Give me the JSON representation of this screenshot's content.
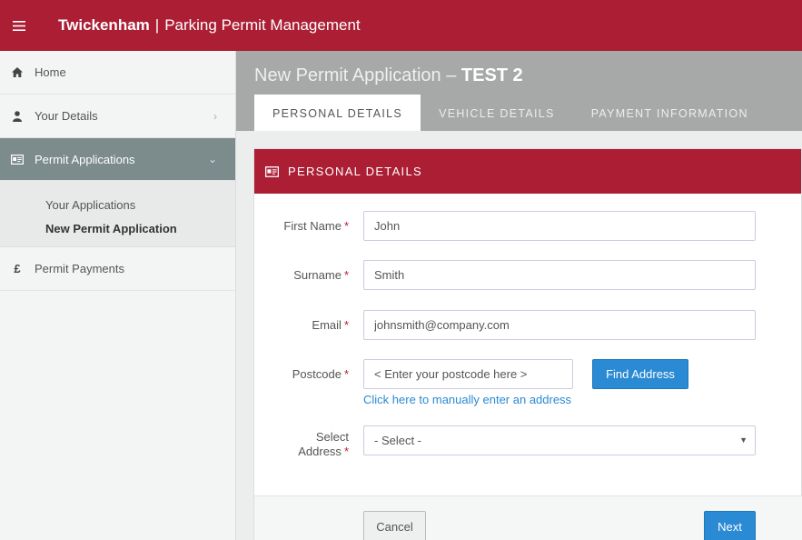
{
  "topbar": {
    "menu_icon": "hamburger-icon",
    "brand_name": "Twickenham",
    "brand_separator": "|",
    "app_name": "Parking Permit Management",
    "color": "#ab1e34"
  },
  "sidebar": {
    "items": [
      {
        "label": "Home",
        "icon": "home-icon"
      },
      {
        "label": "Your Details",
        "icon": "user-icon",
        "chevron": "›"
      },
      {
        "label": "Permit Applications",
        "icon": "id-card-icon",
        "chevron": "⌄",
        "active": true
      },
      {
        "label": "Permit Payments",
        "icon": "pound-icon",
        "icon_glyph": "£"
      }
    ],
    "sub_items": [
      {
        "label": "Your Applications"
      },
      {
        "label": "New Permit Application",
        "current": true
      }
    ]
  },
  "header": {
    "title_prefix": "New Permit Application –",
    "title_bold": "TEST 2",
    "tabs": [
      {
        "label": "PERSONAL DETAILS",
        "active": true
      },
      {
        "label": "VEHICLE DETAILS"
      },
      {
        "label": "PAYMENT INFORMATION"
      }
    ]
  },
  "panel": {
    "title": "PERSONAL DETAILS",
    "icon": "id-card-icon"
  },
  "form": {
    "required_marker": "*",
    "first_name": {
      "label": "First Name",
      "value": "John"
    },
    "surname": {
      "label": "Surname",
      "value": "Smith"
    },
    "email": {
      "label": "Email",
      "value": "johnsmith@company.com"
    },
    "postcode": {
      "label": "Postcode",
      "placeholder": "< Enter your postcode here >"
    },
    "find_address_label": "Find Address",
    "manual_address_link": "Click here to manually enter an address",
    "select_address": {
      "label_line1": "Select",
      "label_line2": "Address",
      "value": "- Select -",
      "caret": "▼"
    }
  },
  "footer": {
    "cancel_label": "Cancel",
    "next_label": "Next"
  },
  "colors": {
    "brand_red": "#ab1e34",
    "sidebar_active": "#7c8b8c",
    "header_gray": "#a7a9a9",
    "primary_blue": "#2a8ad3"
  }
}
